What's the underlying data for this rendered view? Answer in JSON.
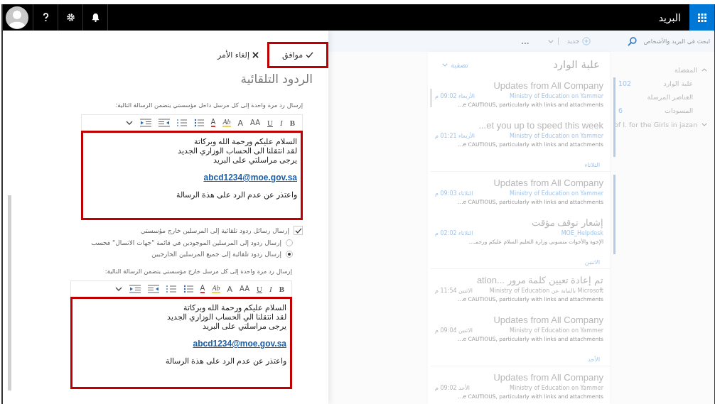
{
  "top_bar": {
    "app_title": "البريد"
  },
  "auto_reply": {
    "ok_label": "موافق",
    "cancel_label": "إلغاء الأمر",
    "title": "الردود التلقائية",
    "inside": {
      "label": "إرسال رد مرة واحدة إلى كل مرسل داخل مؤسستي يتضمن الرسالة التالية:",
      "toolbar": [
        {
          "kind": "bold",
          "glyph": "B"
        },
        {
          "kind": "italic",
          "glyph": "I"
        },
        {
          "kind": "underline",
          "glyph": "U"
        },
        {
          "kind": "font-size",
          "glyph": "AA"
        },
        {
          "kind": "grow-font",
          "glyph": "A"
        },
        {
          "kind": "highlight",
          "glyph": "Ab"
        },
        {
          "kind": "font-color",
          "glyph": "A"
        },
        {
          "kind": "bullets"
        },
        {
          "kind": "numbering"
        },
        {
          "kind": "outdent"
        },
        {
          "kind": "indent"
        },
        {
          "kind": "more"
        }
      ],
      "message": {
        "lines": [
          "السلام عليكم ورحمة الله وبركاتة",
          "لقد انتقلنا الى الحساب الوزاري الجديد",
          "يرجى مراسلتي على البريد"
        ],
        "email": "abcd1234@moe.gov.sa",
        "closing": "واعتذر عن عدم الرد على هذة الرسالة"
      }
    },
    "outside_checkbox": {
      "label": "إرسال رسائل ردود تلقائية إلى المرسلين خارج مؤسستي",
      "checked": true
    },
    "radios": [
      {
        "label": "إرسال ردود إلى المرسلين الموجودين في قائمة \"جهات الاتصال\" فحسب",
        "selected": false
      },
      {
        "label": "إرسال ردود تلقائية إلى جميع المرسلين الخارجيين",
        "selected": true
      }
    ],
    "outside": {
      "label": "إرسال رد مرة واحدة إلى كل مرسل خارج مؤسستي يتضمن الرسالة التالية:",
      "toolbar": [
        {
          "kind": "bold",
          "glyph": "B"
        },
        {
          "kind": "italic",
          "glyph": "I"
        },
        {
          "kind": "underline",
          "glyph": "U"
        },
        {
          "kind": "font-size",
          "glyph": "AA"
        },
        {
          "kind": "grow-font",
          "glyph": "A"
        },
        {
          "kind": "highlight",
          "glyph": "Ab"
        },
        {
          "kind": "font-color",
          "glyph": "A"
        },
        {
          "kind": "bullets"
        },
        {
          "kind": "numbering"
        },
        {
          "kind": "outdent"
        },
        {
          "kind": "indent"
        },
        {
          "kind": "more"
        }
      ],
      "message": {
        "lines": [
          "السلام عليكم ورحمة الله وبركاتة",
          "لقد انتقلنا الي الحساب الوزاري الجديد",
          "يرجى مراسلتي على البريد"
        ],
        "email": "abcd1234@moe.gov.sa",
        "closing": "واعتذر عن عدم الرد على هذة الرسالة"
      }
    }
  },
  "command_bar": {
    "search_placeholder": "ابحث في البريد والأشخاص",
    "new_label": "جديد",
    "more_label": "..."
  },
  "folders": {
    "favorites_label": "المفضلة",
    "expanded": true,
    "items": [
      {
        "name": "علبة الوارد",
        "count": "102"
      },
      {
        "name": "العناصر المرسلة"
      },
      {
        "name": "المسودات",
        "count": "6"
      }
    ],
    "account": {
      "name": "of I. for the Girls in jazan",
      "expanded": false
    }
  },
  "mail": {
    "title": "علبة الوارد",
    "filter_label": "تصفية",
    "items": [
      {
        "kind": "message",
        "subject": "Updates from All Company",
        "sender": "Ministry of Education on Yammer",
        "time": "الأربعاء 09:02 م",
        "preview": "e CAUTIOUS, particularly with links and attachments...",
        "unread": true
      },
      {
        "kind": "message",
        "subject": "et you up to speed this week...",
        "sender": "Ministry of Education on Yammer",
        "time": "الأربعاء 01:21 م",
        "preview": "e CAUTIOUS, particularly with links and attachments...",
        "unread": true
      },
      {
        "kind": "header",
        "label": "الثلاثاء"
      },
      {
        "kind": "message",
        "subject": "Updates from All Company",
        "sender": "Ministry of Education on Yammer",
        "time": "الثلاثاء 09:03 م",
        "preview": "e CAUTIOUS, particularly with links and attachments...",
        "unread": true
      },
      {
        "kind": "message",
        "subject": "إشعار توقف مؤقت",
        "sender": "MOE_Helpdesk",
        "time": "الثلاثاء 02:02 م",
        "preview": "الإخوة والأخوات منسوبي وزارة التعليم السلام عليكم ورحمـ...",
        "unread": true
      },
      {
        "kind": "header",
        "label": "الاثنين"
      },
      {
        "kind": "message",
        "subject": "تم إعادة تعيين كلمة مرور ...ation",
        "sender": "Microsoft بالنيابة عن Ministry of Education",
        "time": "الاثنين 11:54 م",
        "preview": "e CAUTIOUS, particularly with links and attachments...",
        "unread": false
      },
      {
        "kind": "message",
        "subject": "Updates from All Company",
        "sender": "Ministry of Education on Yammer",
        "time": "الاثنين 09:04 م",
        "preview": "e CAUTIOUS, particularly with links and attachments...",
        "unread": false
      },
      {
        "kind": "header",
        "label": "الأحد"
      },
      {
        "kind": "message",
        "subject": "Updates from All Company",
        "sender": "Ministry of Education on Yammer",
        "time": "الأحد 09:02 م",
        "preview": "e CAUTIOUS, particularly with links and attachments...",
        "unread": false
      }
    ]
  }
}
